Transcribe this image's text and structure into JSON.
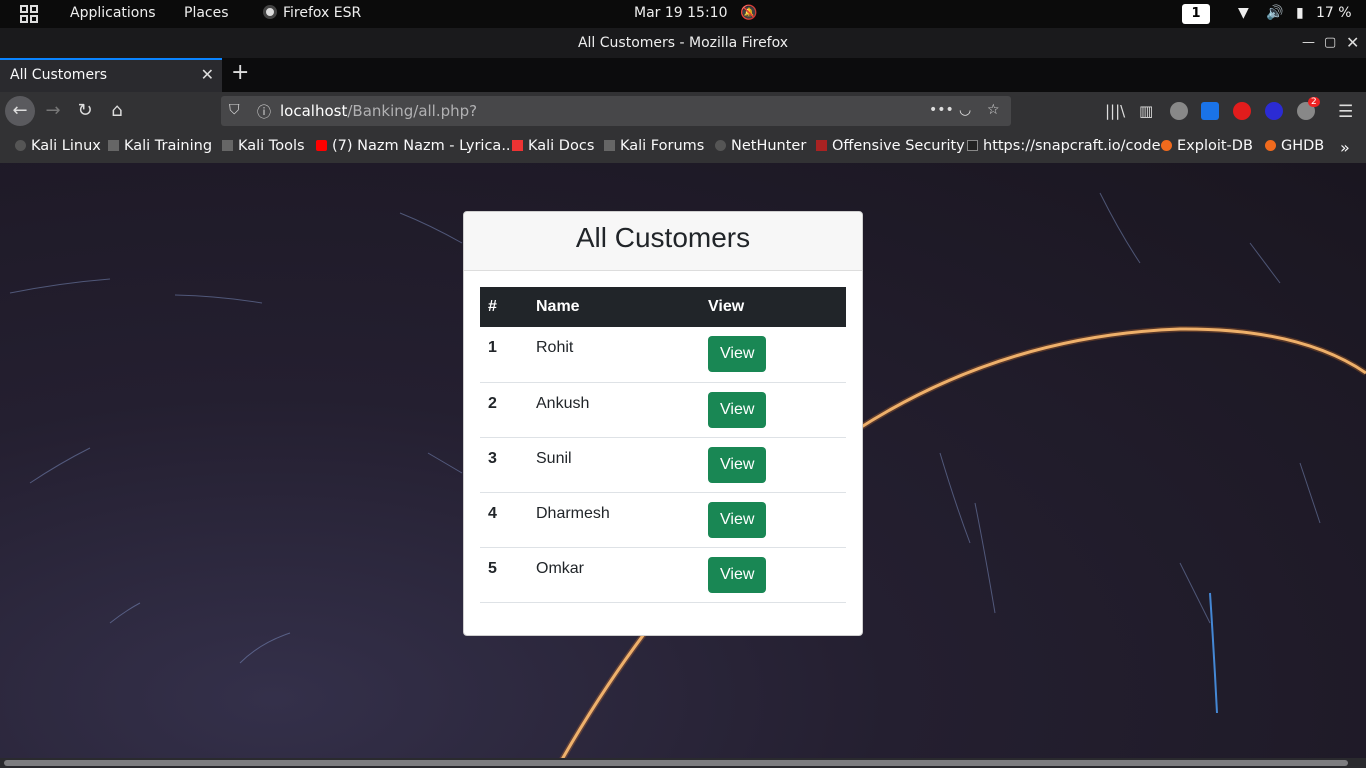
{
  "system_bar": {
    "applications": "Applications",
    "places": "Places",
    "active_app": "Firefox ESR",
    "datetime": "Mar 19  15:10",
    "workspace": "1",
    "battery": "17 %"
  },
  "window": {
    "title": "All Customers - Mozilla Firefox"
  },
  "tab": {
    "title": "All Customers"
  },
  "urlbar": {
    "host": "localhost",
    "path": "/Banking/all.php?"
  },
  "bookmarks": [
    {
      "label": "Kali Linux"
    },
    {
      "label": "Kali Training"
    },
    {
      "label": "Kali Tools"
    },
    {
      "label": "(7) Nazm Nazm - Lyrica..."
    },
    {
      "label": "Kali Docs"
    },
    {
      "label": "Kali Forums"
    },
    {
      "label": "NetHunter"
    },
    {
      "label": "Offensive Security"
    },
    {
      "label": "https://snapcraft.io/code"
    },
    {
      "label": "Exploit-DB"
    },
    {
      "label": "GHDB"
    }
  ],
  "extension_badge": "2",
  "page": {
    "heading": "All Customers",
    "columns": [
      "#",
      "Name",
      "View"
    ],
    "rows": [
      {
        "id": "1",
        "name": "Rohit",
        "action": "View"
      },
      {
        "id": "2",
        "name": "Ankush",
        "action": "View"
      },
      {
        "id": "3",
        "name": "Sunil",
        "action": "View"
      },
      {
        "id": "4",
        "name": "Dharmesh",
        "action": "View"
      },
      {
        "id": "5",
        "name": "Omkar",
        "action": "View"
      }
    ]
  },
  "colors": {
    "accent": "#0a84ff",
    "button": "#198754",
    "table_header": "#212529"
  }
}
